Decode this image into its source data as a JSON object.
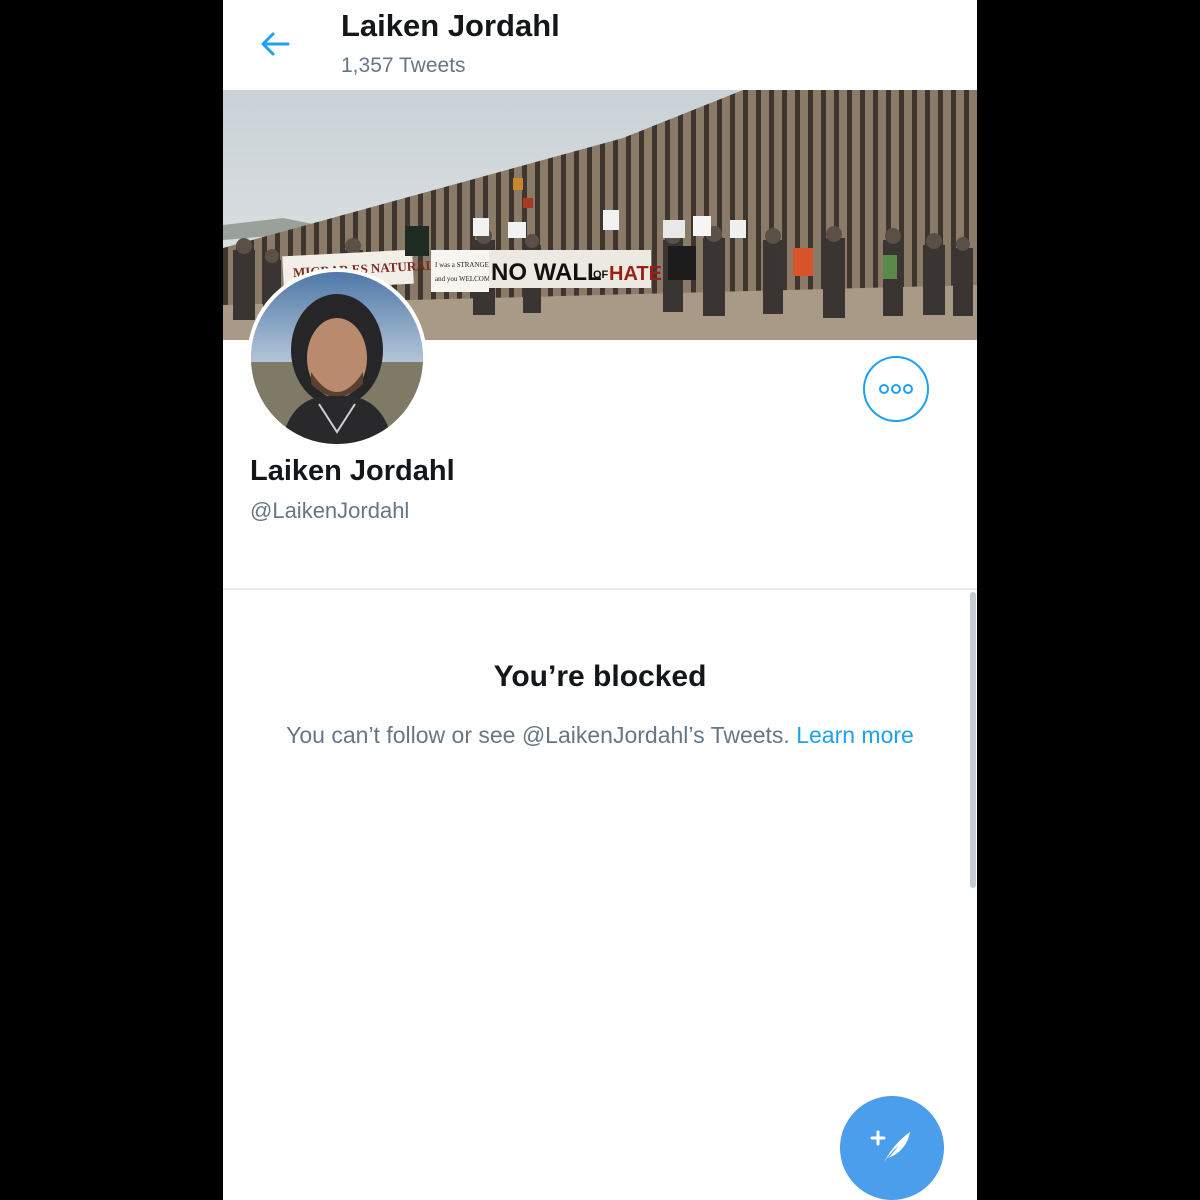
{
  "header": {
    "title": "Laiken Jordahl",
    "subtitle": "1,357 Tweets",
    "back_icon": "arrow-left-icon"
  },
  "banner": {
    "signs": [
      "MIGRAR ES NATURAL",
      "I was a STRANGER and you WELCOMED ME",
      "NO WALL OF HATE"
    ]
  },
  "profile": {
    "name": "Laiken Jordahl",
    "handle": "@LaikenJordahl",
    "more_icon": "more-options-icon"
  },
  "blocked": {
    "title": "You’re blocked",
    "message": "You can’t follow or see @LaikenJordahl’s Tweets.",
    "link": "Learn more"
  },
  "fab": {
    "icon": "compose-tweet-icon"
  },
  "colors": {
    "accent": "#1da1f2",
    "fab": "#4a9eeb",
    "text_primary": "#14171a",
    "text_secondary": "#657786"
  }
}
